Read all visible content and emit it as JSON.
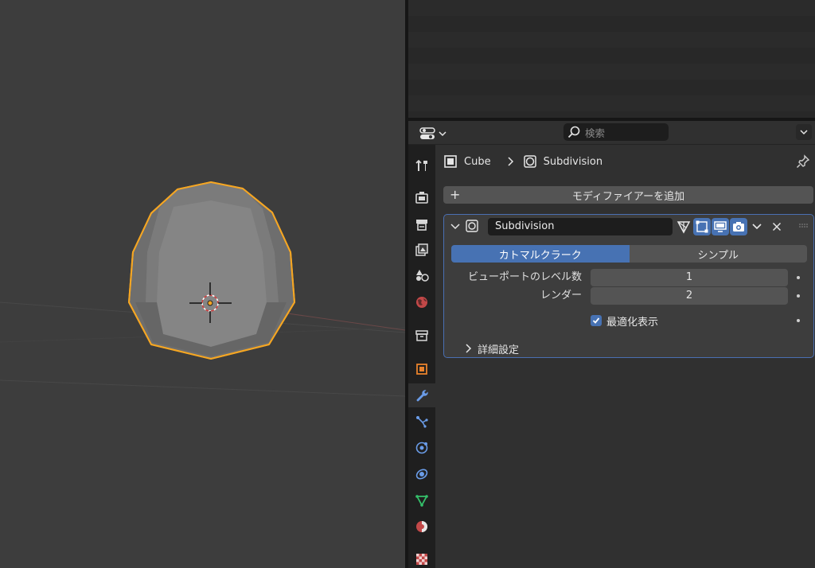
{
  "properties": {
    "search": {
      "placeholder": "検索"
    },
    "breadcrumb": {
      "object": "Cube",
      "modifier": "Subdivision"
    },
    "add_modifier_label": "モディファイアーを追加",
    "modifier": {
      "name": "Subdivision",
      "method": {
        "options": [
          "カトマルクラーク",
          "シンプル"
        ],
        "selected": "カトマルクラーク"
      },
      "viewport_levels": {
        "label": "ビューポートのレベル数",
        "value": "1"
      },
      "render_levels": {
        "label": "レンダー",
        "value": "2"
      },
      "optimal_display": {
        "label": "最適化表示",
        "checked": true
      },
      "advanced_label": "詳細設定"
    },
    "tabs": [
      "tool-icon",
      "render-icon",
      "output-icon",
      "view-layer-icon",
      "scene-icon",
      "world-icon",
      "collection-icon",
      "object-icon",
      "modifier-icon",
      "particles-icon",
      "physics-icon",
      "constraints-icon",
      "data-icon",
      "material-icon",
      "texture-icon"
    ],
    "active_tab": "modifier-icon"
  },
  "colors": {
    "accent": "#4772b3",
    "selection_outline": "#f5a623",
    "viewport_bg": "#3d3d3d"
  }
}
